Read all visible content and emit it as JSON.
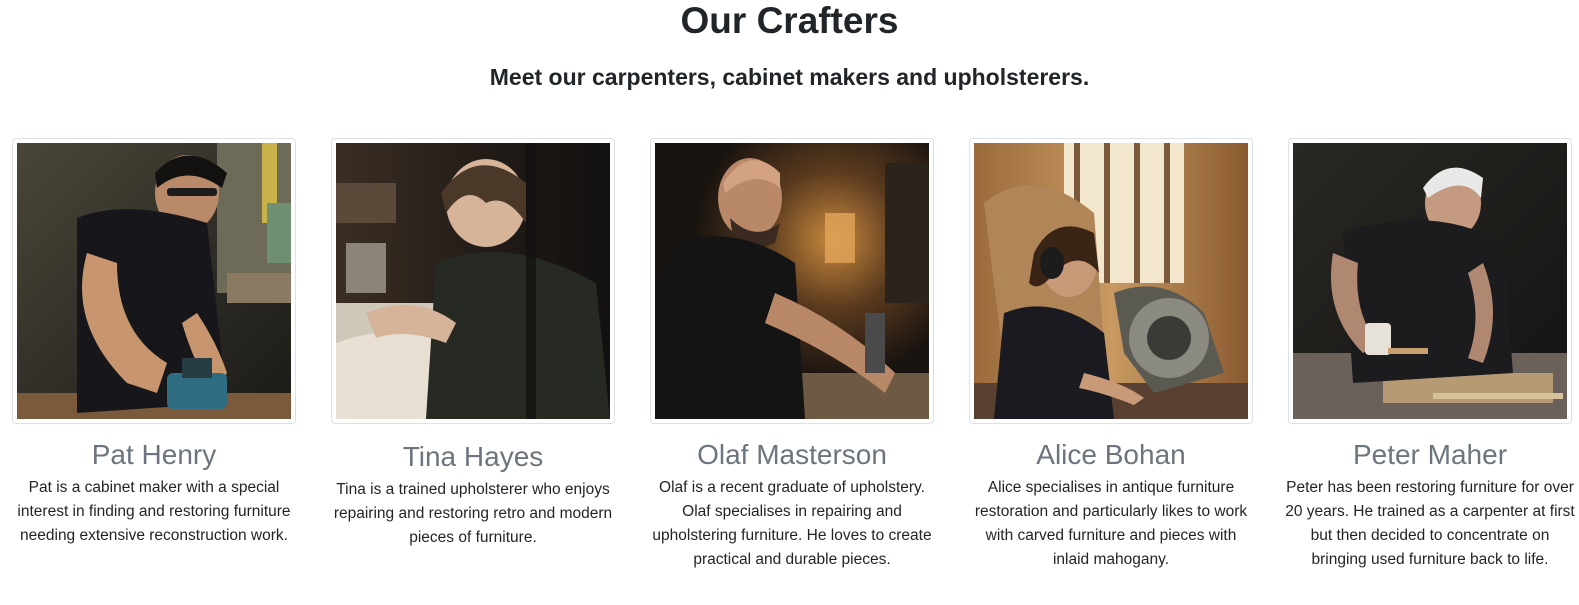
{
  "page": {
    "title": "Our Crafters",
    "subtitle": "Meet our carpenters, cabinet makers and upholsterers."
  },
  "crafters": [
    {
      "name": "Pat Henry",
      "bio": "Pat is a cabinet maker with a special interest in finding and restoring furniture needing extensive reconstruction work.",
      "photo_alt": "Pat Henry working with a hand router in a workshop"
    },
    {
      "name": "Tina Hayes",
      "bio": "Tina is a trained upholsterer who enjoys repairing and restoring retro and modern pieces of furniture.",
      "photo_alt": "Tina Hayes working at an upholstery bench"
    },
    {
      "name": "Olaf Masterson",
      "bio": "Olaf is a recent graduate of upholstery. Olaf specialises in repairing and upholstering furniture. He loves to create practical and durable pieces.",
      "photo_alt": "Olaf Masterson working at a table saw"
    },
    {
      "name": "Alice Bohan",
      "bio": "Alice specialises in antique furniture restoration and particularly likes to work with carved furniture and pieces with inlaid mahogany.",
      "photo_alt": "Alice Bohan using a mitre saw wearing ear defenders"
    },
    {
      "name": "Peter Maher",
      "bio": "Peter has been restoring furniture for over 20 years. He trained as a carpenter at first but then decided to concentrate on bringing used furniture back to life.",
      "photo_alt": "Peter Maher carving wood with a mallet and chisel"
    }
  ]
}
